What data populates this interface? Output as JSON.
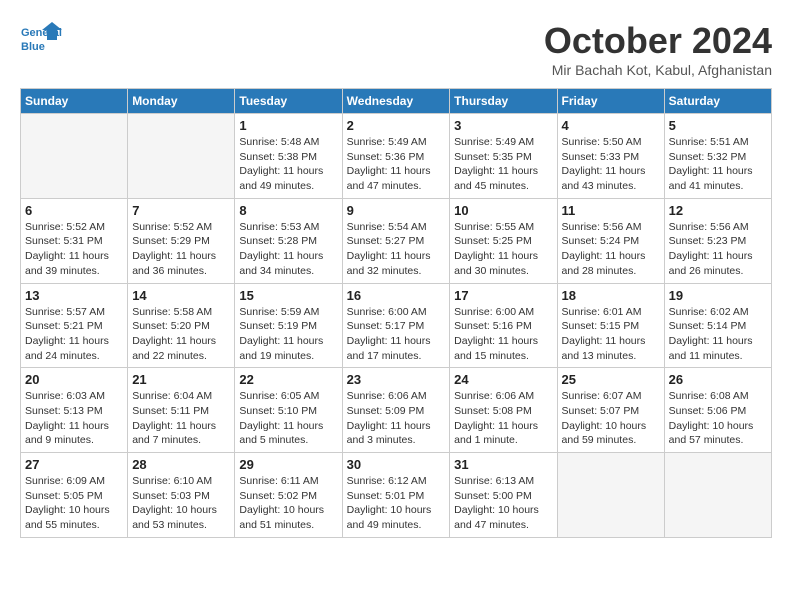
{
  "logo": {
    "line1": "General",
    "line2": "Blue"
  },
  "title": "October 2024",
  "location": "Mir Bachah Kot, Kabul, Afghanistan",
  "headers": [
    "Sunday",
    "Monday",
    "Tuesday",
    "Wednesday",
    "Thursday",
    "Friday",
    "Saturday"
  ],
  "weeks": [
    [
      {
        "day": "",
        "empty": true
      },
      {
        "day": "",
        "empty": true
      },
      {
        "day": "1",
        "sunrise": "5:48 AM",
        "sunset": "5:38 PM",
        "daylight": "11 hours and 49 minutes."
      },
      {
        "day": "2",
        "sunrise": "5:49 AM",
        "sunset": "5:36 PM",
        "daylight": "11 hours and 47 minutes."
      },
      {
        "day": "3",
        "sunrise": "5:49 AM",
        "sunset": "5:35 PM",
        "daylight": "11 hours and 45 minutes."
      },
      {
        "day": "4",
        "sunrise": "5:50 AM",
        "sunset": "5:33 PM",
        "daylight": "11 hours and 43 minutes."
      },
      {
        "day": "5",
        "sunrise": "5:51 AM",
        "sunset": "5:32 PM",
        "daylight": "11 hours and 41 minutes."
      }
    ],
    [
      {
        "day": "6",
        "sunrise": "5:52 AM",
        "sunset": "5:31 PM",
        "daylight": "11 hours and 39 minutes."
      },
      {
        "day": "7",
        "sunrise": "5:52 AM",
        "sunset": "5:29 PM",
        "daylight": "11 hours and 36 minutes."
      },
      {
        "day": "8",
        "sunrise": "5:53 AM",
        "sunset": "5:28 PM",
        "daylight": "11 hours and 34 minutes."
      },
      {
        "day": "9",
        "sunrise": "5:54 AM",
        "sunset": "5:27 PM",
        "daylight": "11 hours and 32 minutes."
      },
      {
        "day": "10",
        "sunrise": "5:55 AM",
        "sunset": "5:25 PM",
        "daylight": "11 hours and 30 minutes."
      },
      {
        "day": "11",
        "sunrise": "5:56 AM",
        "sunset": "5:24 PM",
        "daylight": "11 hours and 28 minutes."
      },
      {
        "day": "12",
        "sunrise": "5:56 AM",
        "sunset": "5:23 PM",
        "daylight": "11 hours and 26 minutes."
      }
    ],
    [
      {
        "day": "13",
        "sunrise": "5:57 AM",
        "sunset": "5:21 PM",
        "daylight": "11 hours and 24 minutes."
      },
      {
        "day": "14",
        "sunrise": "5:58 AM",
        "sunset": "5:20 PM",
        "daylight": "11 hours and 22 minutes."
      },
      {
        "day": "15",
        "sunrise": "5:59 AM",
        "sunset": "5:19 PM",
        "daylight": "11 hours and 19 minutes."
      },
      {
        "day": "16",
        "sunrise": "6:00 AM",
        "sunset": "5:17 PM",
        "daylight": "11 hours and 17 minutes."
      },
      {
        "day": "17",
        "sunrise": "6:00 AM",
        "sunset": "5:16 PM",
        "daylight": "11 hours and 15 minutes."
      },
      {
        "day": "18",
        "sunrise": "6:01 AM",
        "sunset": "5:15 PM",
        "daylight": "11 hours and 13 minutes."
      },
      {
        "day": "19",
        "sunrise": "6:02 AM",
        "sunset": "5:14 PM",
        "daylight": "11 hours and 11 minutes."
      }
    ],
    [
      {
        "day": "20",
        "sunrise": "6:03 AM",
        "sunset": "5:13 PM",
        "daylight": "11 hours and 9 minutes."
      },
      {
        "day": "21",
        "sunrise": "6:04 AM",
        "sunset": "5:11 PM",
        "daylight": "11 hours and 7 minutes."
      },
      {
        "day": "22",
        "sunrise": "6:05 AM",
        "sunset": "5:10 PM",
        "daylight": "11 hours and 5 minutes."
      },
      {
        "day": "23",
        "sunrise": "6:06 AM",
        "sunset": "5:09 PM",
        "daylight": "11 hours and 3 minutes."
      },
      {
        "day": "24",
        "sunrise": "6:06 AM",
        "sunset": "5:08 PM",
        "daylight": "11 hours and 1 minute."
      },
      {
        "day": "25",
        "sunrise": "6:07 AM",
        "sunset": "5:07 PM",
        "daylight": "10 hours and 59 minutes."
      },
      {
        "day": "26",
        "sunrise": "6:08 AM",
        "sunset": "5:06 PM",
        "daylight": "10 hours and 57 minutes."
      }
    ],
    [
      {
        "day": "27",
        "sunrise": "6:09 AM",
        "sunset": "5:05 PM",
        "daylight": "10 hours and 55 minutes."
      },
      {
        "day": "28",
        "sunrise": "6:10 AM",
        "sunset": "5:03 PM",
        "daylight": "10 hours and 53 minutes."
      },
      {
        "day": "29",
        "sunrise": "6:11 AM",
        "sunset": "5:02 PM",
        "daylight": "10 hours and 51 minutes."
      },
      {
        "day": "30",
        "sunrise": "6:12 AM",
        "sunset": "5:01 PM",
        "daylight": "10 hours and 49 minutes."
      },
      {
        "day": "31",
        "sunrise": "6:13 AM",
        "sunset": "5:00 PM",
        "daylight": "10 hours and 47 minutes."
      },
      {
        "day": "",
        "empty": true
      },
      {
        "day": "",
        "empty": true
      }
    ]
  ]
}
